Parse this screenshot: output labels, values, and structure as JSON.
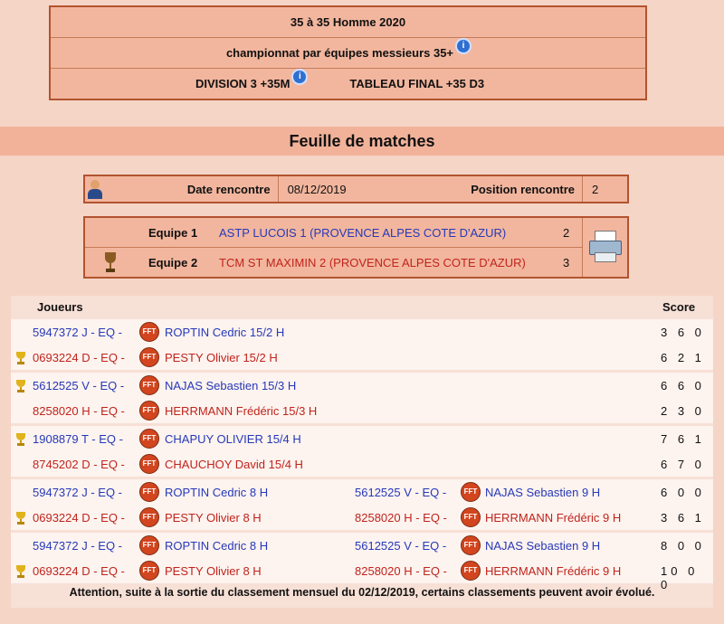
{
  "header": {
    "line1": "35  à 35  Homme  2020",
    "line2": "championnat par équipes messieurs 35+",
    "division": "DIVISION 3 +35M",
    "tableau": "TABLEAU FINAL +35 D3",
    "info_icon": "info-icon"
  },
  "title": "Feuille de matches",
  "meeting": {
    "date_label": "Date rencontre",
    "date_value": "08/12/2019",
    "position_label": "Position rencontre",
    "position_value": "2"
  },
  "teams": [
    {
      "label": "Equipe 1",
      "name": "ASTP LUCOIS 1 (PROVENCE ALPES COTE D'AZUR)",
      "score": "2",
      "color": "#2639b8"
    },
    {
      "label": "Equipe 2",
      "name": "TCM ST MAXIMIN 2 (PROVENCE ALPES COTE D'AZUR)",
      "score": "3",
      "color": "#c0241c"
    }
  ],
  "players_header": {
    "players": "Joueurs",
    "score": "Score"
  },
  "fft_badge": "FFT",
  "matches": [
    {
      "rows": [
        {
          "winner": false,
          "color": "blue",
          "p1_id": "5947372 J - EQ -",
          "p1_name": "ROPTIN Cedric  15/2 H",
          "score": "3 6 0"
        },
        {
          "winner": true,
          "color": "red",
          "p1_id": "0693224 D - EQ -",
          "p1_name": "PESTY  Olivier 15/2 H",
          "score": "6 2 1"
        }
      ]
    },
    {
      "rows": [
        {
          "winner": true,
          "color": "blue",
          "p1_id": "5612525 V - EQ -",
          "p1_name": "NAJAS  Sebastien  15/3 H",
          "score": "6 6 0"
        },
        {
          "winner": false,
          "color": "red",
          "p1_id": "8258020 H - EQ -",
          "p1_name": "HERRMANN  Frédéric 15/3 H",
          "score": "2 3 0"
        }
      ]
    },
    {
      "rows": [
        {
          "winner": true,
          "color": "blue",
          "p1_id": "1908879 T - EQ -",
          "p1_name": "CHAPUY  OLIVIER  15/4 H",
          "score": "7 6 1"
        },
        {
          "winner": false,
          "color": "red",
          "p1_id": "8745202 D - EQ -",
          "p1_name": "CHAUCHOY  David 15/4 H",
          "score": "6 7 0"
        }
      ]
    },
    {
      "rows": [
        {
          "winner": false,
          "color": "blue",
          "p1_id": "5947372 J - EQ -",
          "p1_name": "ROPTIN  Cedric  8 H",
          "p2_id": "5612525 V - EQ -",
          "p2_name": "NAJAS  Sebastien  9 H",
          "score": "6 0 0"
        },
        {
          "winner": true,
          "color": "red",
          "p1_id": "0693224 D - EQ -",
          "p1_name": "PESTY  Olivier 8 H",
          "p2_id": "8258020 H - EQ -",
          "p2_name": "HERRMANN  Frédéric 9 H",
          "score": "3 6 1"
        }
      ]
    },
    {
      "rows": [
        {
          "winner": false,
          "color": "blue",
          "p1_id": "5947372 J - EQ -",
          "p1_name": "ROPTIN  Cedric  8 H",
          "p2_id": "5612525 V - EQ -",
          "p2_name": "NAJAS  Sebastien  9 H",
          "score": "8 0 0"
        },
        {
          "winner": true,
          "color": "red",
          "p1_id": "0693224 D - EQ -",
          "p1_name": "PESTY  Olivier 8 H",
          "p2_id": "8258020 H - EQ -",
          "p2_name": "HERRMANN  Frédéric 9 H",
          "score": "10 0 0"
        }
      ]
    }
  ],
  "footer": "Attention, suite à la sortie du classement mensuel du 02/12/2019, certains classements peuvent avoir évolué."
}
